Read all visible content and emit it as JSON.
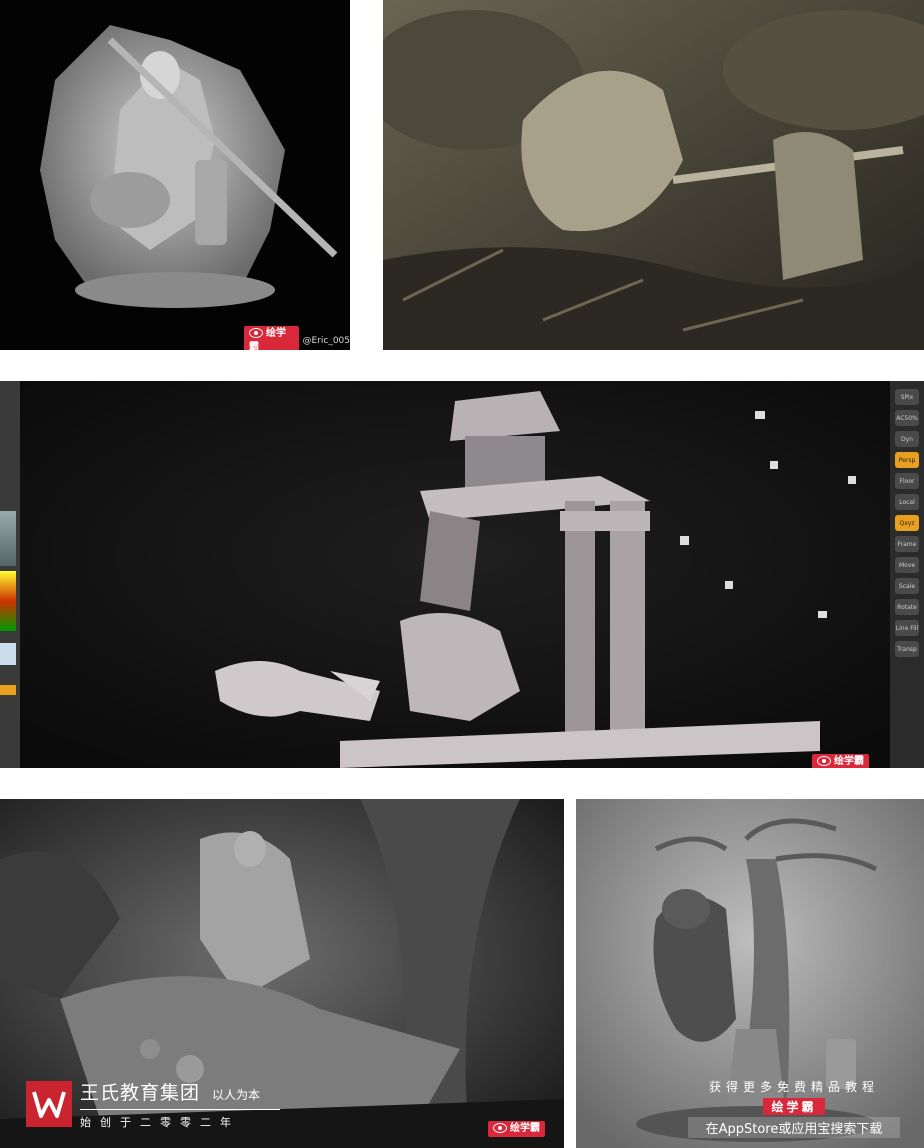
{
  "watermark": {
    "brand": "绘学霸",
    "handle": "@Eric_005"
  },
  "brand_block": {
    "name": "王氏教育集团",
    "motto": "以人为本",
    "founded": "始创于二零零二年"
  },
  "promo": {
    "line1": "获得更多免费精品教程",
    "badge": "绘学霸",
    "line3": "在AppStore或应用宝搜索下载"
  },
  "zbrush_ui": {
    "buttons": [
      "SPix",
      "AC50%",
      "Dyn",
      "Persp",
      "Floor",
      "Local",
      "Qxyz",
      "Frame",
      "Move",
      "Scale",
      "Rotate",
      "Line Fill",
      "Transp"
    ]
  },
  "colors": {
    "brand_red": "#d8283a",
    "ui_orange": "#e8a01e"
  }
}
